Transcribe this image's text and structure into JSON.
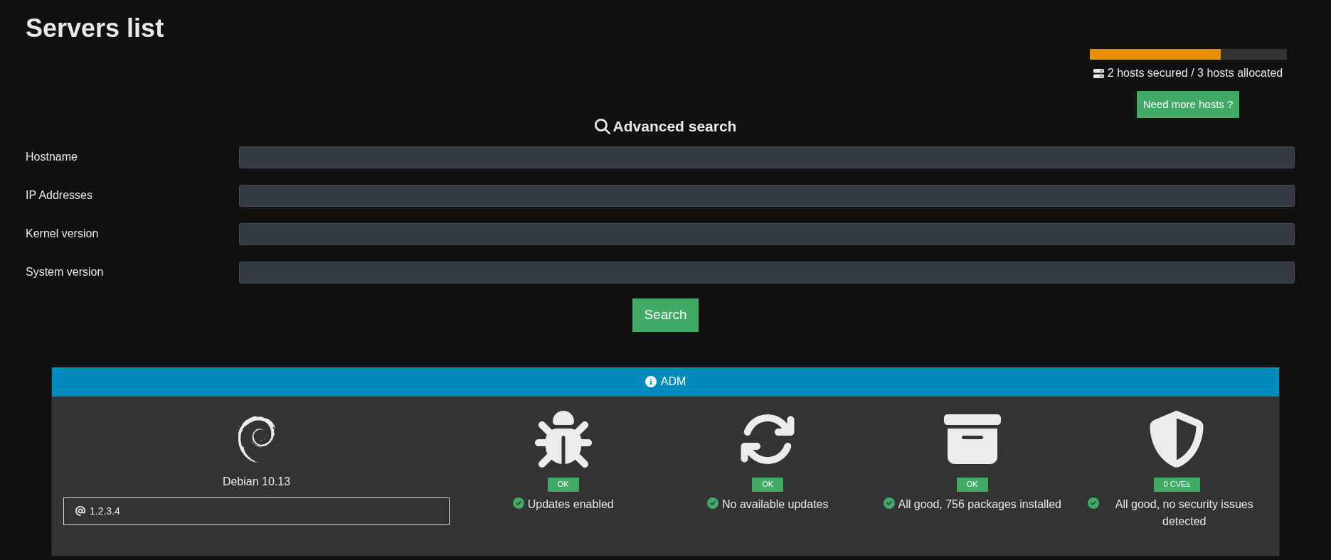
{
  "title": "Servers list",
  "hosts": {
    "level": 0.667,
    "summary": "2 hosts secured / 3 hosts allocated",
    "button": "Need more hosts ?"
  },
  "advanced_search": {
    "title": "Advanced search",
    "fields": [
      {
        "label": "Hostname"
      },
      {
        "label": "IP Addresses"
      },
      {
        "label": "Kernel version"
      },
      {
        "label": "System version"
      }
    ],
    "button": "Search"
  },
  "servers": [
    {
      "name": "ADM",
      "os": "Debian 10.13",
      "ip": "1.2.3.4",
      "checks": [
        {
          "kind": "bug",
          "badge": "OK",
          "status": "Updates enabled",
          "ok": true
        },
        {
          "kind": "sync",
          "badge": "OK",
          "status": "No available updates",
          "ok": true
        },
        {
          "kind": "packages",
          "badge": "OK",
          "status": "All good, 756 packages installed",
          "ok": true
        },
        {
          "kind": "security",
          "badge": "0 CVEs",
          "status": "All good, no security issues detected",
          "ok": true
        }
      ]
    }
  ]
}
